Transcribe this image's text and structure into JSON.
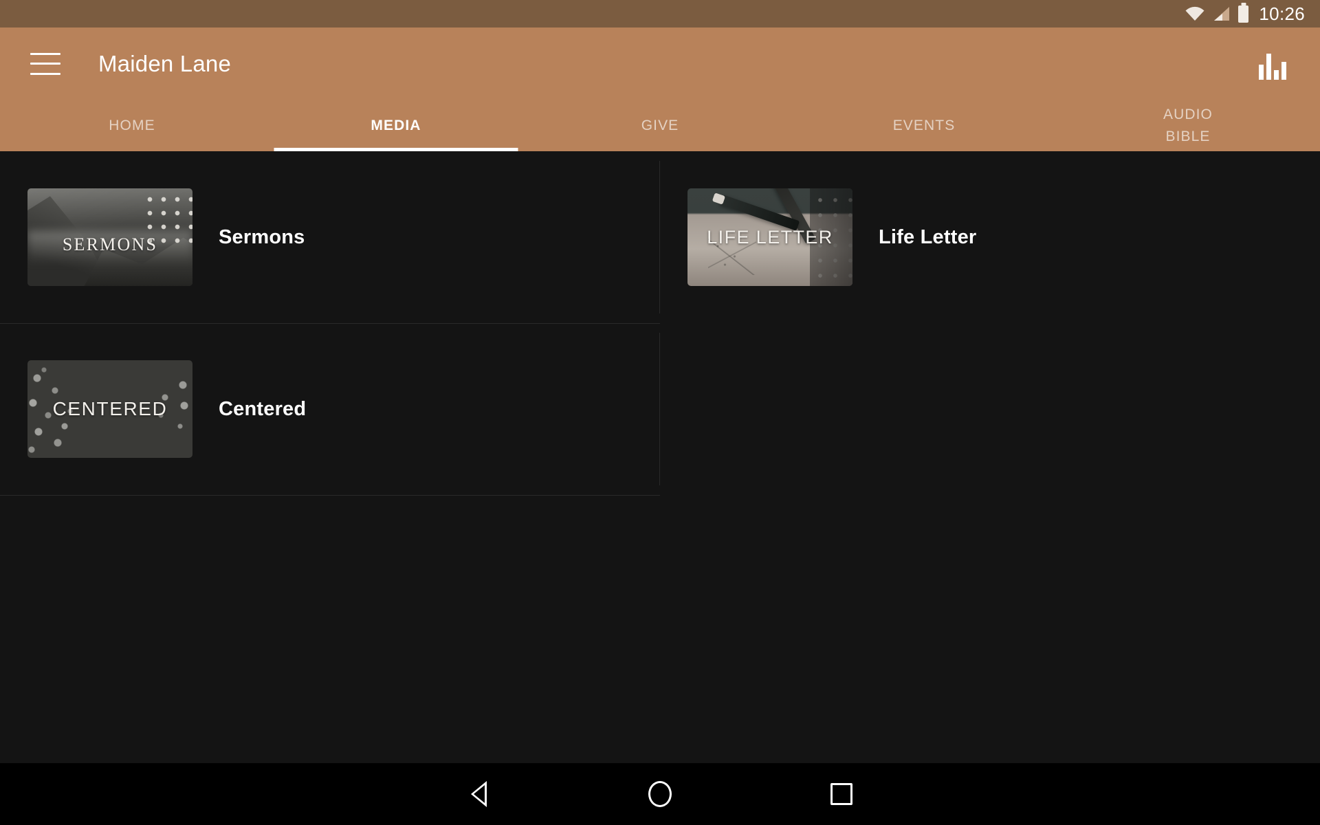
{
  "status_bar": {
    "time": "10:26",
    "icons": [
      "wifi-icon",
      "cellular-signal-icon",
      "battery-icon"
    ]
  },
  "app_bar": {
    "menu_icon": "hamburger-menu-icon",
    "title": "Maiden Lane",
    "action_icon": "bar-chart-icon",
    "background_color": "#b8825a",
    "status_bar_color": "#7b5c40"
  },
  "tabs": [
    {
      "label": "HOME",
      "active": false
    },
    {
      "label": "MEDIA",
      "active": true
    },
    {
      "label": "GIVE",
      "active": false
    },
    {
      "label": "EVENTS",
      "active": false
    },
    {
      "label": "AUDIO\nBIBLE",
      "active": false
    }
  ],
  "media_items": [
    {
      "label": "Sermons",
      "thumb_title": "SERMONS",
      "thumb_art": "grayscale-mountain-valley-photo"
    },
    {
      "label": "Life Letter",
      "thumb_title": "LIFE LETTER",
      "thumb_art": "fountain-pens-on-paper-photo"
    },
    {
      "label": "Centered",
      "thumb_title": "CENTERED",
      "thumb_art": "dark-gray-speckled-graphic"
    }
  ],
  "content": {
    "background_color": "#141414",
    "text_color": "#ffffff"
  },
  "nav_bar": {
    "back": "back-triangle-icon",
    "home": "home-circle-icon",
    "recents": "recents-square-icon"
  }
}
